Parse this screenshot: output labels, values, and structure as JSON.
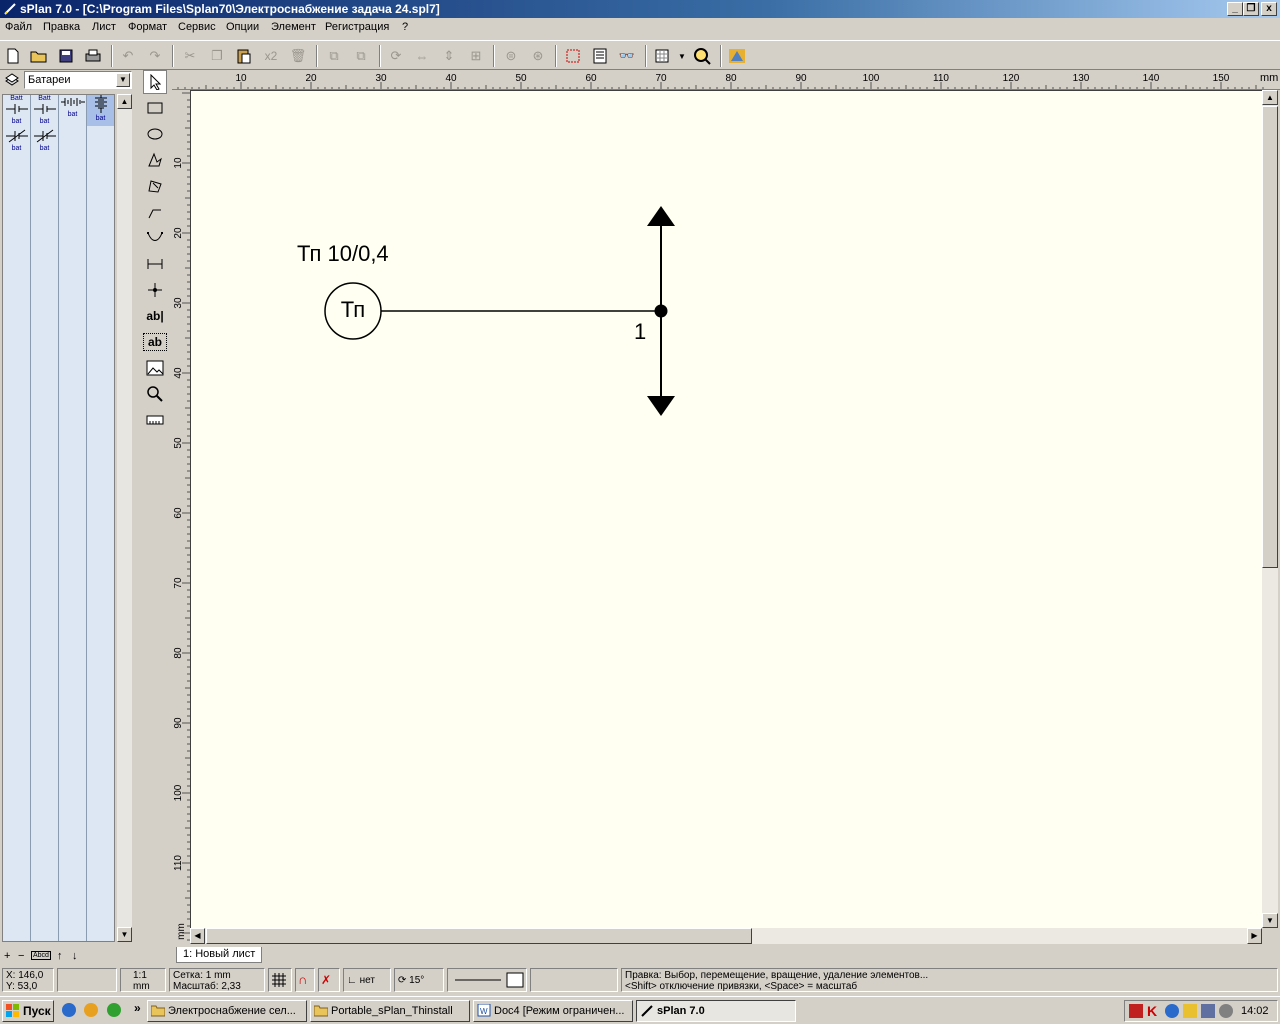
{
  "window": {
    "title": "sPlan 7.0 - [C:\\Program Files\\Splan70\\Электроснабжение задача 24.spl7]",
    "controls": [
      "_",
      "❐",
      "x"
    ]
  },
  "menu": [
    "Файл",
    "Правка",
    "Лист",
    "Формат",
    "Сервис",
    "Опции",
    "Элемент",
    "Регистрация",
    "?"
  ],
  "toolbar": {
    "copy_count_label": "x2"
  },
  "library": {
    "selected": "Батареи",
    "components": [
      {
        "top": "Batt",
        "bottom": "bat"
      },
      {
        "top": "Batt",
        "bottom": "bat"
      },
      {
        "top": "",
        "bottom": "bat"
      },
      {
        "top": "",
        "bottom": "bat"
      },
      {
        "top": "",
        "bottom": "bat"
      },
      {
        "top": "",
        "bottom": "bat"
      }
    ],
    "bottom_buttons": [
      "+",
      "−",
      "Abcd",
      "↑",
      "↓"
    ]
  },
  "rulers": {
    "top_ticks": [
      "10",
      "20",
      "30",
      "40",
      "50",
      "60",
      "70",
      "80",
      "90",
      "100",
      "110",
      "120",
      "130",
      "140",
      "150"
    ],
    "top_unit": "mm",
    "left_ticks": [
      "10",
      "20",
      "30",
      "40",
      "50",
      "60",
      "70",
      "80",
      "90",
      "100",
      "110"
    ],
    "left_unit": "mm"
  },
  "drawing": {
    "transformer_label": "Тп 10/0,4",
    "transformer_symbol": "Тп",
    "node_label": "1",
    "arrow_up": "arrow-up",
    "arrow_down": "arrow-down"
  },
  "sheet_tab": "1: Новый лист",
  "status": {
    "x": "X: 146,0",
    "y": "Y: 53,0",
    "scale_ratio": "1:1",
    "scale_unit": "mm",
    "grid": "Сетка: 1 mm",
    "zoom": "Масштаб:  2,33",
    "snap": "нет",
    "angle": "15°",
    "hint_line1": "Правка: Выбор, перемещение, вращение, удаление элементов...",
    "hint_line2": "<Shift> отключение привязки, <Space> = масштаб"
  },
  "taskbar": {
    "start": "Пуск",
    "more": "»",
    "items": [
      {
        "label": "Электроснабжение сел...",
        "active": false
      },
      {
        "label": "Portable_sPlan_Thinstall",
        "active": false
      },
      {
        "label": "Doc4 [Режим ограничен...",
        "active": false
      },
      {
        "label": "sPlan 7.0",
        "active": true
      }
    ],
    "clock": "14:02"
  },
  "colors": {
    "title_start": "#0a246a",
    "title_end": "#a6caf0",
    "canvas_bg": "#fffff2",
    "library_bg": "#dde7f4"
  }
}
